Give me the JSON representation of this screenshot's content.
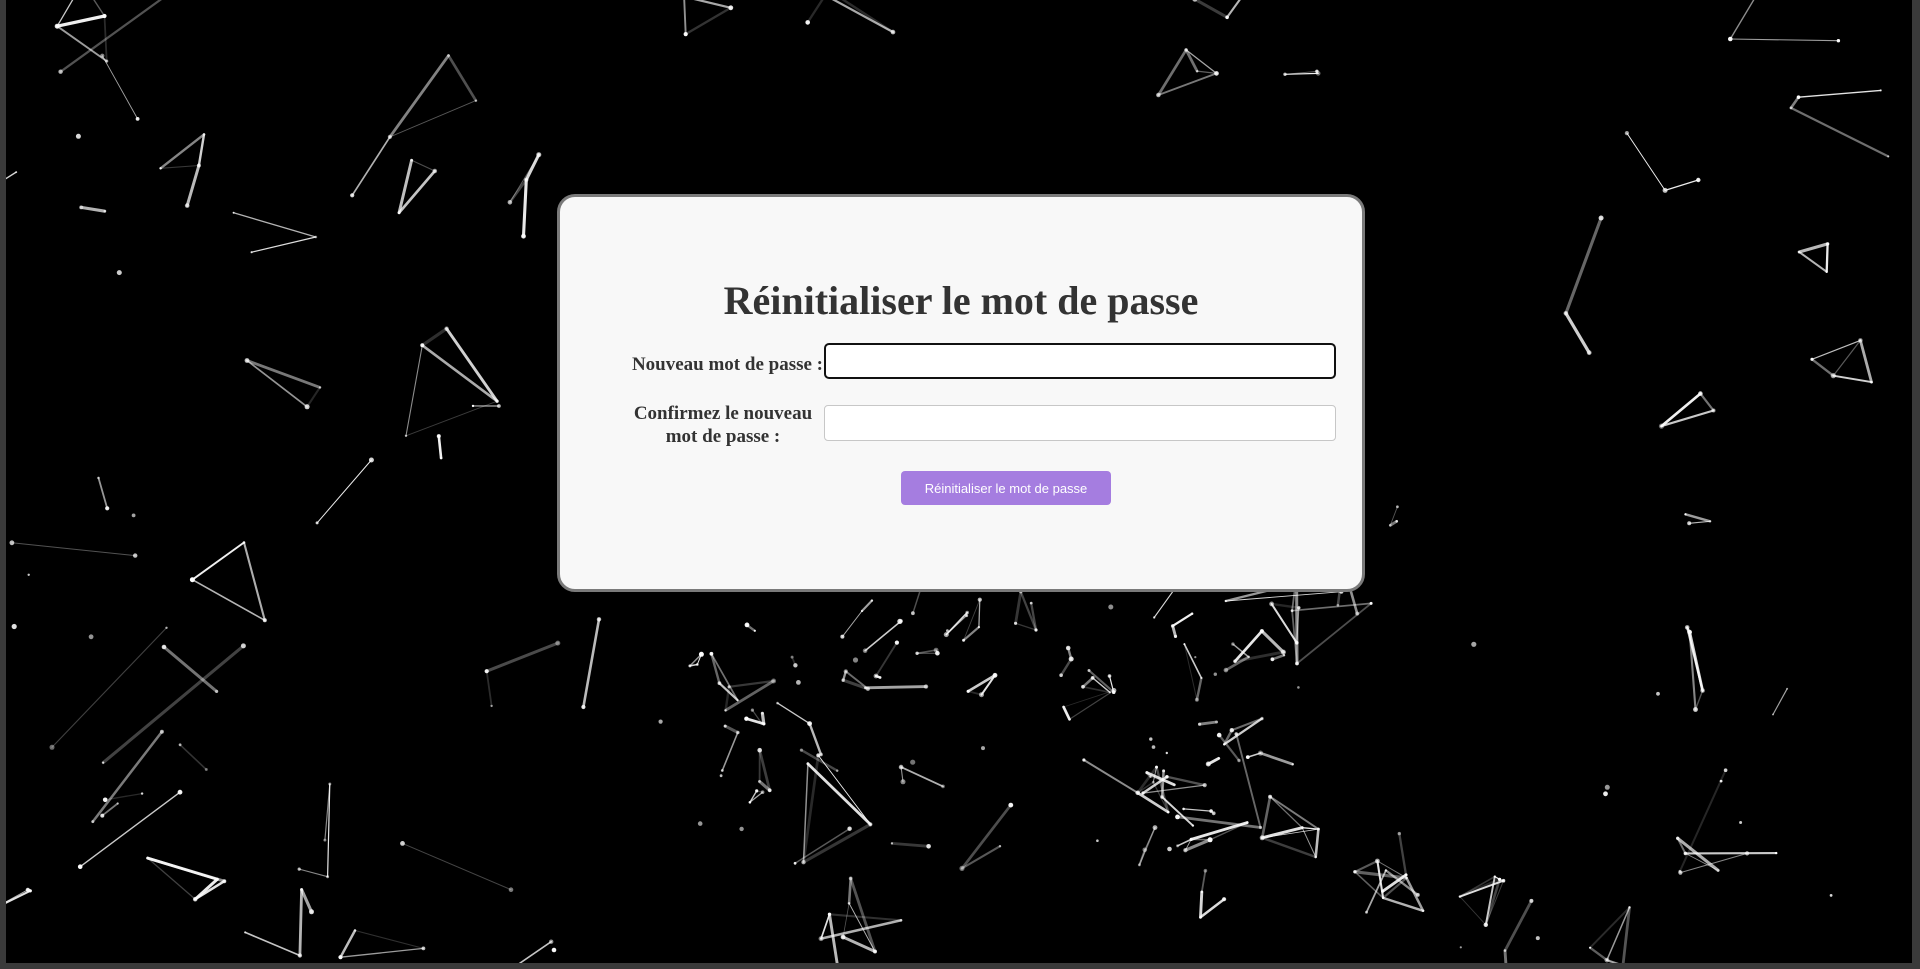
{
  "page": {
    "background_color": "#000000",
    "network_line_color": "#ffffff"
  },
  "reset_form": {
    "title": "Réinitialiser le mot de passe",
    "new_password_label": "Nouveau mot de passe :",
    "new_password_value": "",
    "confirm_password_label": "Confirmez le nouveau mot de passe :",
    "confirm_password_value": "",
    "submit_label": "Réinitialiser le mot de passe",
    "accent_color": "#a57de0"
  }
}
